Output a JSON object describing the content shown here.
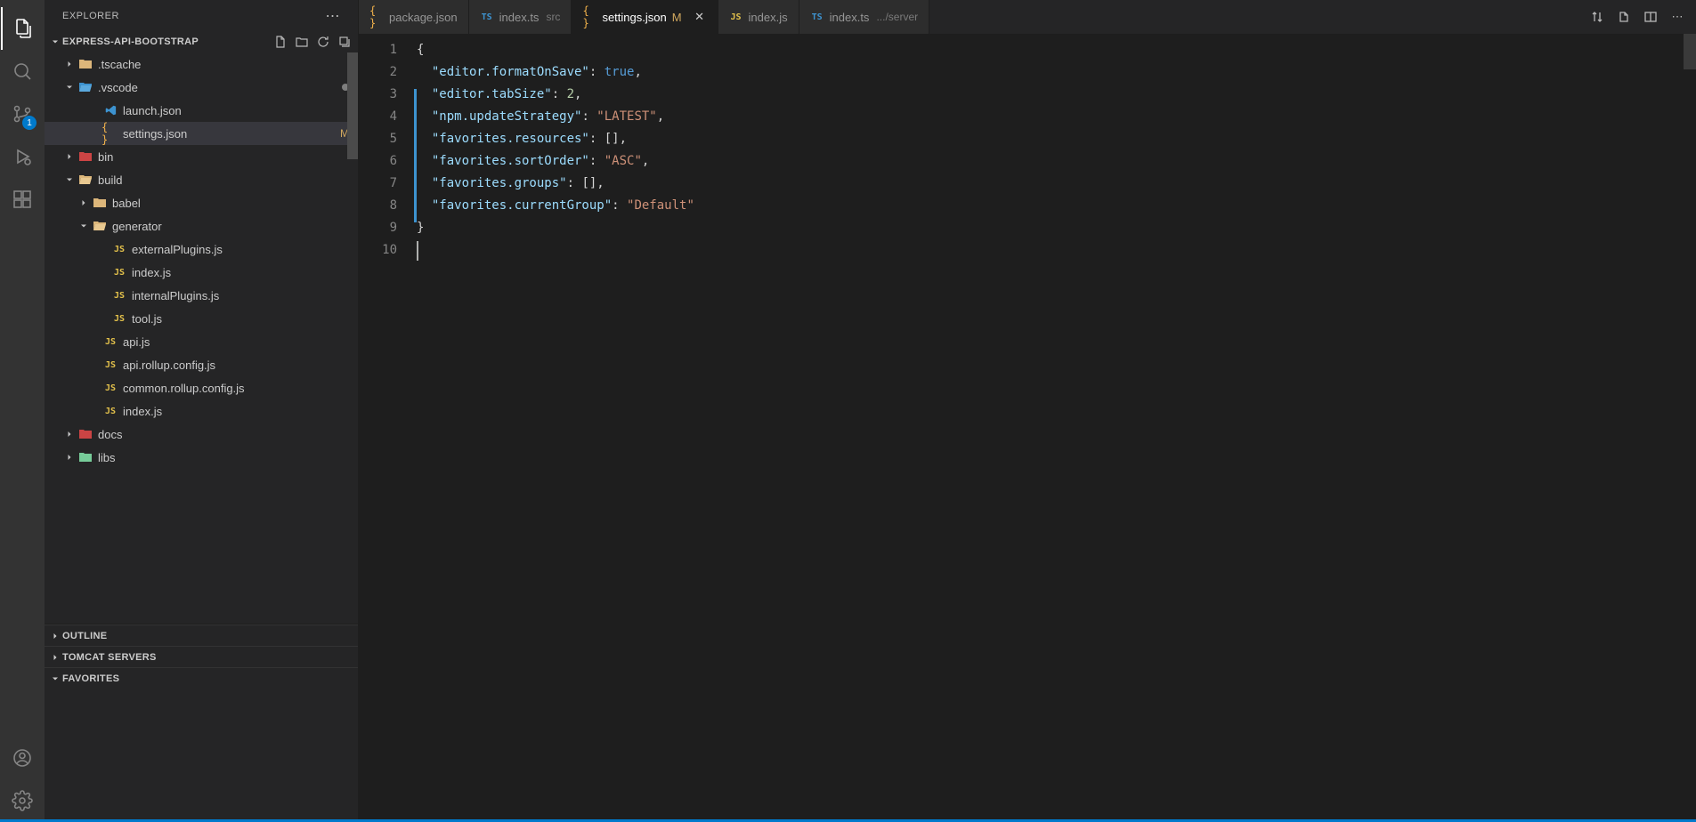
{
  "sidebar": {
    "title": "EXPLORER",
    "project": "EXPRESS-API-BOOTSTRAP",
    "scm_badge": "1"
  },
  "tree": {
    "items": [
      {
        "name": ".tscache",
        "indent": 20,
        "chev": "right",
        "icon": "folder"
      },
      {
        "name": ".vscode",
        "indent": 20,
        "chev": "down",
        "icon": "folder-open-blue",
        "dot": true
      },
      {
        "name": "launch.json",
        "indent": 48,
        "chev": "",
        "icon": "vs"
      },
      {
        "name": "settings.json",
        "indent": 48,
        "chev": "",
        "icon": "json",
        "status": "M",
        "selected": true
      },
      {
        "name": "bin",
        "indent": 20,
        "chev": "right",
        "icon": "folder-red"
      },
      {
        "name": "build",
        "indent": 20,
        "chev": "down",
        "icon": "folder-open"
      },
      {
        "name": "babel",
        "indent": 36,
        "chev": "right",
        "icon": "folder"
      },
      {
        "name": "generator",
        "indent": 36,
        "chev": "down",
        "icon": "folder-openp"
      },
      {
        "name": "externalPlugins.js",
        "indent": 58,
        "chev": "",
        "icon": "js"
      },
      {
        "name": "index.js",
        "indent": 58,
        "chev": "",
        "icon": "js"
      },
      {
        "name": "internalPlugins.js",
        "indent": 58,
        "chev": "",
        "icon": "js"
      },
      {
        "name": "tool.js",
        "indent": 58,
        "chev": "",
        "icon": "js"
      },
      {
        "name": "api.js",
        "indent": 48,
        "chev": "",
        "icon": "js"
      },
      {
        "name": "api.rollup.config.js",
        "indent": 48,
        "chev": "",
        "icon": "js"
      },
      {
        "name": "common.rollup.config.js",
        "indent": 48,
        "chev": "",
        "icon": "js"
      },
      {
        "name": "index.js",
        "indent": 48,
        "chev": "",
        "icon": "js"
      },
      {
        "name": "docs",
        "indent": 20,
        "chev": "right",
        "icon": "folder-red"
      },
      {
        "name": "libs",
        "indent": 20,
        "chev": "right",
        "icon": "folder-green"
      }
    ]
  },
  "sections": {
    "outline": "OUTLINE",
    "tomcat": "TOMCAT SERVERS",
    "favorites": "FAVORITES"
  },
  "tabs": [
    {
      "icon": "json",
      "label": "package.json",
      "desc": "",
      "active": false
    },
    {
      "icon": "ts",
      "label": "index.ts",
      "desc": "src",
      "active": false
    },
    {
      "icon": "json",
      "label": "settings.json",
      "desc": "",
      "mod": "M",
      "active": true,
      "close": true
    },
    {
      "icon": "js",
      "label": "index.js",
      "desc": "",
      "active": false
    },
    {
      "icon": "ts",
      "label": "index.ts",
      "desc": ".../server",
      "active": false
    }
  ],
  "editor": {
    "line_count": 10,
    "content": {
      "l1": {
        "k": "",
        "v": "{"
      },
      "l2": {
        "k": "editor.formatOnSave",
        "v": "true",
        "t": "bool"
      },
      "l3": {
        "k": "editor.tabSize",
        "v": "2",
        "t": "num"
      },
      "l4": {
        "k": "npm.updateStrategy",
        "v": "LATEST",
        "t": "str"
      },
      "l5": {
        "k": "favorites.resources",
        "v": "[]",
        "t": "arr"
      },
      "l6": {
        "k": "favorites.sortOrder",
        "v": "ASC",
        "t": "str"
      },
      "l7": {
        "k": "favorites.groups",
        "v": "[]",
        "t": "arr"
      },
      "l8": {
        "k": "favorites.currentGroup",
        "v": "Default",
        "t": "str",
        "last": true
      },
      "l9": {
        "k": "",
        "v": "}"
      }
    }
  }
}
